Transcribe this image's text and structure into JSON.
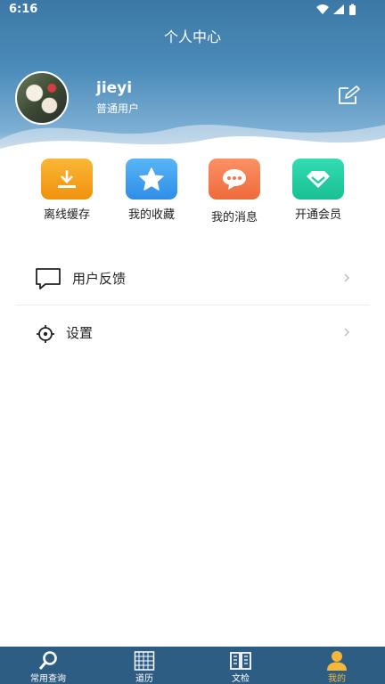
{
  "status_bar": {
    "time": "6:16"
  },
  "header": {
    "title": "个人中心"
  },
  "profile": {
    "username": "jieyi",
    "role": "普通用户"
  },
  "quick_actions": [
    {
      "label": "离线缓存",
      "icon": "download-icon",
      "color": "#f5a020"
    },
    {
      "label": "我的收藏",
      "icon": "star-icon",
      "color": "#3a9ef0"
    },
    {
      "label": "我的消息",
      "icon": "chat-bubble-icon",
      "color": "#f57a4a"
    },
    {
      "label": "开通会员",
      "icon": "diamond-icon",
      "color": "#22cfa3"
    }
  ],
  "menu": [
    {
      "label": "用户反馈",
      "icon": "feedback-icon"
    },
    {
      "label": "设置",
      "icon": "settings-icon"
    }
  ],
  "tabs": [
    {
      "label": "常用查询",
      "icon": "search-icon",
      "active": false
    },
    {
      "label": "道历",
      "icon": "calendar-icon",
      "active": false
    },
    {
      "label": "文检",
      "icon": "book-icon",
      "active": false
    },
    {
      "label": "我的",
      "icon": "person-icon",
      "active": true
    }
  ],
  "colors": {
    "header_blue": "#3c78a6",
    "tab_bar": "#2e5d84",
    "tab_active": "#f5b73a"
  }
}
